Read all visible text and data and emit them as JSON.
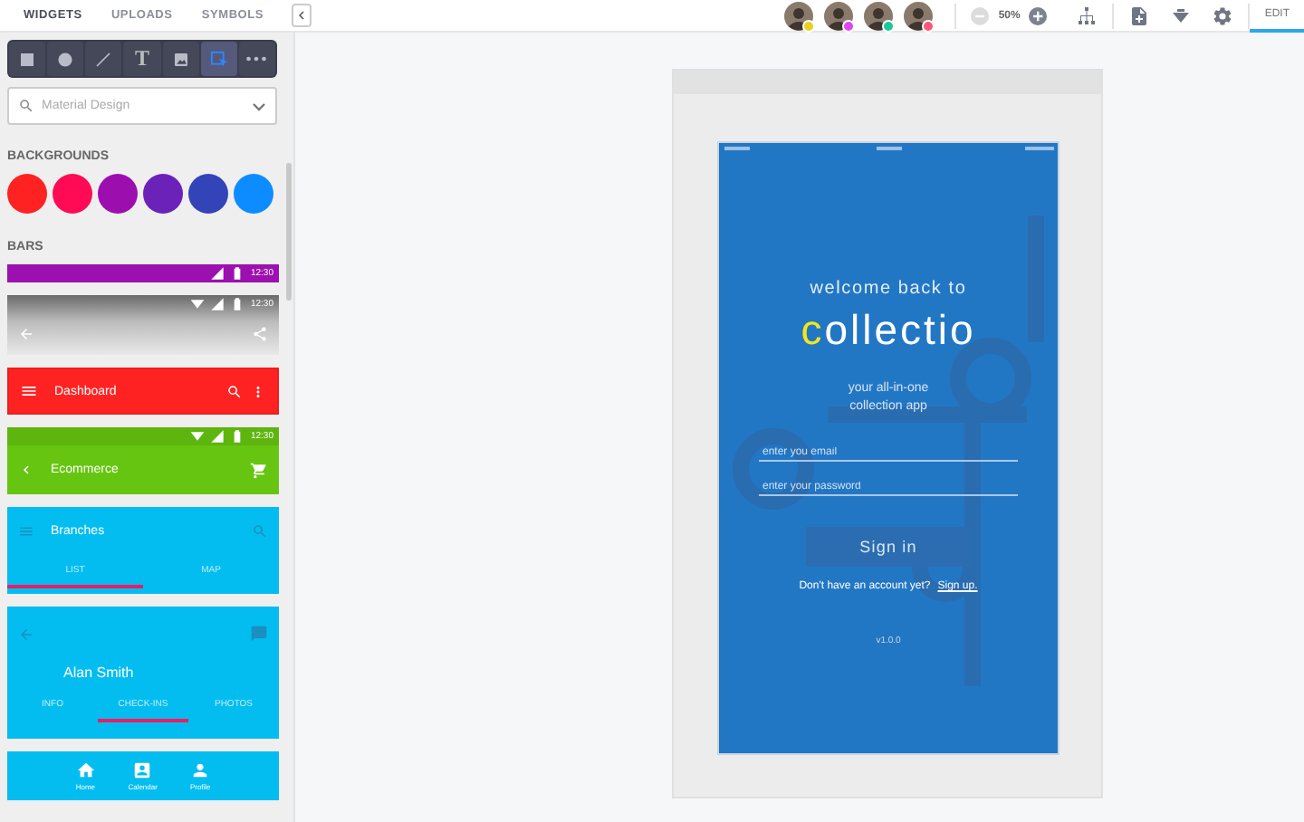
{
  "top_tabs": [
    {
      "label": "WIDGETS",
      "selected": true
    },
    {
      "label": "UPLOADS",
      "selected": false
    },
    {
      "label": "SYMBOLS",
      "selected": false
    }
  ],
  "collaborators": [
    {
      "color": "#e8d21c"
    },
    {
      "color": "#e046f0"
    },
    {
      "color": "#1cc99b"
    },
    {
      "color": "#ff5577"
    }
  ],
  "zoom": "50%",
  "mode_tab": {
    "label": "EDIT",
    "selected": true
  },
  "tools": [
    {
      "kind": "rectangle",
      "selected": false
    },
    {
      "kind": "ellipse",
      "selected": false
    },
    {
      "kind": "line",
      "selected": false
    },
    {
      "kind": "text",
      "label": "T",
      "selected": false
    },
    {
      "kind": "image",
      "selected": false
    },
    {
      "kind": "select",
      "selected": true
    },
    {
      "kind": "more",
      "selected": false
    }
  ],
  "search": {
    "placeholder": "Material Design"
  },
  "backgrounds": {
    "title": "BACKGROUNDS",
    "swatches": [
      {
        "color": "#ff2222"
      },
      {
        "color": "#ff0a55"
      },
      {
        "color": "#9c0fae"
      },
      {
        "color": "#6a22b8"
      },
      {
        "color": "#3344b8"
      },
      {
        "color": "#0d8cff"
      }
    ]
  },
  "bars": {
    "title": "BARS",
    "widgets": [
      {
        "kind": "status",
        "color": "#9c10b0",
        "time": "12:30"
      },
      {
        "kind": "gradient",
        "color": "#6a6a6a",
        "time": "12:30"
      },
      {
        "kind": "toolbar",
        "color": "#ff2222",
        "title": "Dashboard"
      },
      {
        "kind": "toolbar_status",
        "color": "#66c510",
        "time": "12:30",
        "title": "Ecommerce"
      },
      {
        "kind": "tabbar",
        "color": "#03bdf0",
        "title": "Branches",
        "tabs": [
          {
            "label": "LIST",
            "selected": true
          },
          {
            "label": "MAP",
            "selected": false
          }
        ]
      },
      {
        "kind": "profile",
        "color": "#03bdf0",
        "title": "Alan Smith",
        "tabs": [
          {
            "label": "INFO",
            "selected": false
          },
          {
            "label": "CHECK-INS",
            "selected": true
          },
          {
            "label": "PHOTOS",
            "selected": false
          }
        ]
      },
      {
        "kind": "bottom_nav",
        "color": "#03bdf0",
        "items": [
          {
            "kind": "home",
            "label": "Home"
          },
          {
            "kind": "calendar",
            "label": "Calendar"
          },
          {
            "kind": "person",
            "label": "Profile"
          }
        ]
      }
    ]
  },
  "phone": {
    "welcome": "welcome back to",
    "brand": {
      "accent": "c",
      "rest": "ollectio"
    },
    "tagline": [
      "your all-in-one",
      "collection app"
    ],
    "email": {
      "placeholder": "enter you email"
    },
    "password": {
      "placeholder": "enter your password"
    },
    "button": "Sign in",
    "prompt": "Don't have an account yet?",
    "link": "Sign up.",
    "version": "v1.0.0"
  }
}
